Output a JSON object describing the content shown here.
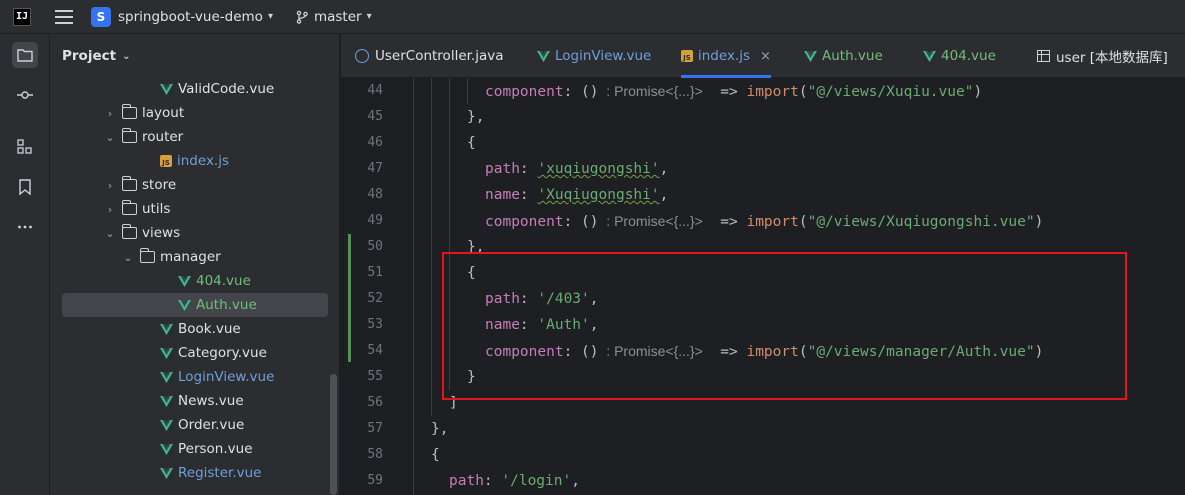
{
  "titlebar": {
    "app_logo": "IJ",
    "project_badge": "S",
    "project_name": "springboot-vue-demo",
    "branch": "master"
  },
  "project_panel": {
    "title": "Project",
    "tree": [
      {
        "label": "ValidCode.vue",
        "type": "vue",
        "color": "default"
      },
      {
        "label": "layout",
        "type": "folder",
        "expanded": false
      },
      {
        "label": "router",
        "type": "folder",
        "expanded": true
      },
      {
        "label": "index.js",
        "type": "js",
        "color": "blue"
      },
      {
        "label": "store",
        "type": "folder",
        "expanded": false
      },
      {
        "label": "utils",
        "type": "folder",
        "expanded": false
      },
      {
        "label": "views",
        "type": "folder",
        "expanded": true
      },
      {
        "label": "manager",
        "type": "folder",
        "expanded": true
      },
      {
        "label": "404.vue",
        "type": "vue",
        "color": "green"
      },
      {
        "label": "Auth.vue",
        "type": "vue",
        "color": "green",
        "selected": true
      },
      {
        "label": "Book.vue",
        "type": "vue",
        "color": "default"
      },
      {
        "label": "Category.vue",
        "type": "vue",
        "color": "default"
      },
      {
        "label": "LoginView.vue",
        "type": "vue",
        "color": "blue"
      },
      {
        "label": "News.vue",
        "type": "vue",
        "color": "default"
      },
      {
        "label": "Order.vue",
        "type": "vue",
        "color": "default"
      },
      {
        "label": "Person.vue",
        "type": "vue",
        "color": "default"
      },
      {
        "label": "Register.vue",
        "type": "vue",
        "color": "blue"
      }
    ]
  },
  "tabs": [
    {
      "label": "UserController.java",
      "icon": "java-class-icon",
      "color": "default"
    },
    {
      "label": "LoginView.vue",
      "icon": "vue-icon",
      "color": "blue"
    },
    {
      "label": "index.js",
      "icon": "js-icon",
      "color": "blue",
      "active": true,
      "close": "×"
    },
    {
      "label": "Auth.vue",
      "icon": "vue-icon",
      "color": "green"
    },
    {
      "label": "404.vue",
      "icon": "vue-icon",
      "color": "green"
    },
    {
      "label": "user [本地数据库]",
      "icon": "table-icon",
      "color": "default"
    }
  ],
  "editor": {
    "line_numbers": [
      "44",
      "45",
      "46",
      "47",
      "48",
      "49",
      "50",
      "51",
      "52",
      "53",
      "54",
      "55",
      "56",
      "57",
      "58",
      "59"
    ],
    "hint_text": "Promise<{...}>",
    "code": {
      "l44_key": "component",
      "l44_paren": "()",
      "l44_arrow": "=>",
      "l44_import": "import",
      "l44_str": "\"@/views/Xuqiu.vue\"",
      "l45": "},",
      "l46": "{",
      "l47_key": "path",
      "l47_str": "'xuqiugongshi'",
      "l48_key": "name",
      "l48_str": "'Xuqiugongshi'",
      "l49_key": "component",
      "l49_str": "\"@/views/Xuqiugongshi.vue\"",
      "l50": "},",
      "l51": "{",
      "l52_key": "path",
      "l52_str": "'/403'",
      "l53_key": "name",
      "l53_str": "'Auth'",
      "l54_key": "component",
      "l54_str": "\"@/views/manager/Auth.vue\"",
      "l55": "}",
      "l56": "]",
      "l57": "},",
      "l58": "{",
      "l59_key": "path",
      "l59_str": "'/login'"
    }
  },
  "colors": {
    "accent": "#3574f0",
    "highlight_box": "#e0181b",
    "string": "#6aab73",
    "property": "#c77dbb",
    "keyword": "#cf8e6d"
  }
}
